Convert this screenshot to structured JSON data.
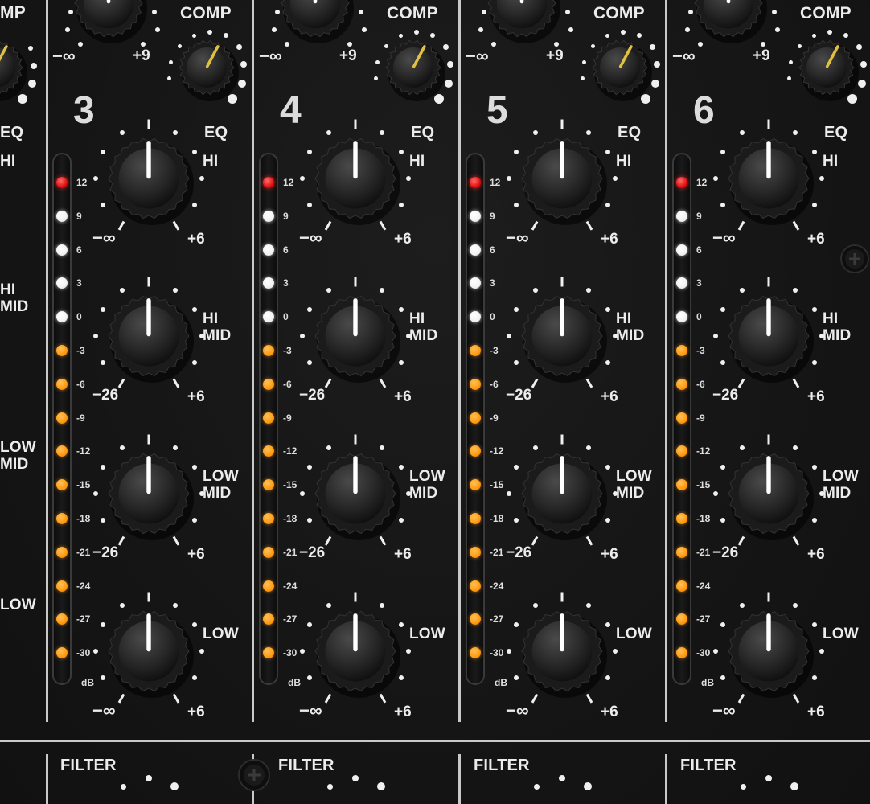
{
  "meter_ticks": [
    "12",
    "9",
    "6",
    "3",
    "0",
    "-3",
    "-6",
    "-9",
    "-12",
    "-15",
    "-18",
    "-21",
    "-24",
    "-27",
    "-30"
  ],
  "meter_unit": "dB",
  "led_colors": {
    "red": "#e01010",
    "white": "#f2f2f2",
    "orange": "#ff9a10"
  },
  "labels": {
    "comp": "COMP",
    "comp_min": "−∞",
    "comp_max": "+9",
    "eq": "EQ",
    "filter": "FILTER"
  },
  "knob_labels": [
    {
      "line1": "HI",
      "line2": "",
      "min": "−∞",
      "max": "+6"
    },
    {
      "line1": "HI",
      "line2": "MID",
      "min": "−26",
      "max": "+6"
    },
    {
      "line1": "LOW",
      "line2": "MID",
      "min": "−26",
      "max": "+6"
    },
    {
      "line1": "LOW",
      "line2": "",
      "min": "−∞",
      "max": "+6"
    }
  ],
  "partial_channel": {
    "comp_label": "MP",
    "eq_label": "EQ",
    "labels": [
      {
        "line1": "HI",
        "line2": ""
      },
      {
        "line1": "HI",
        "line2": "MID"
      },
      {
        "line1": "LOW",
        "line2": "MID"
      },
      {
        "line1": "LOW",
        "line2": ""
      }
    ]
  },
  "channels": [
    {
      "number": "3",
      "meter_lit": 15
    },
    {
      "number": "4",
      "meter_lit": 15
    },
    {
      "number": "5",
      "meter_lit": 15
    },
    {
      "number": "6",
      "meter_lit": 15
    }
  ],
  "icons": {
    "screw": "phillips-screw-icon",
    "knob_pointer": "white-line-indicator",
    "comp_pointer": "gold-line-indicator"
  }
}
